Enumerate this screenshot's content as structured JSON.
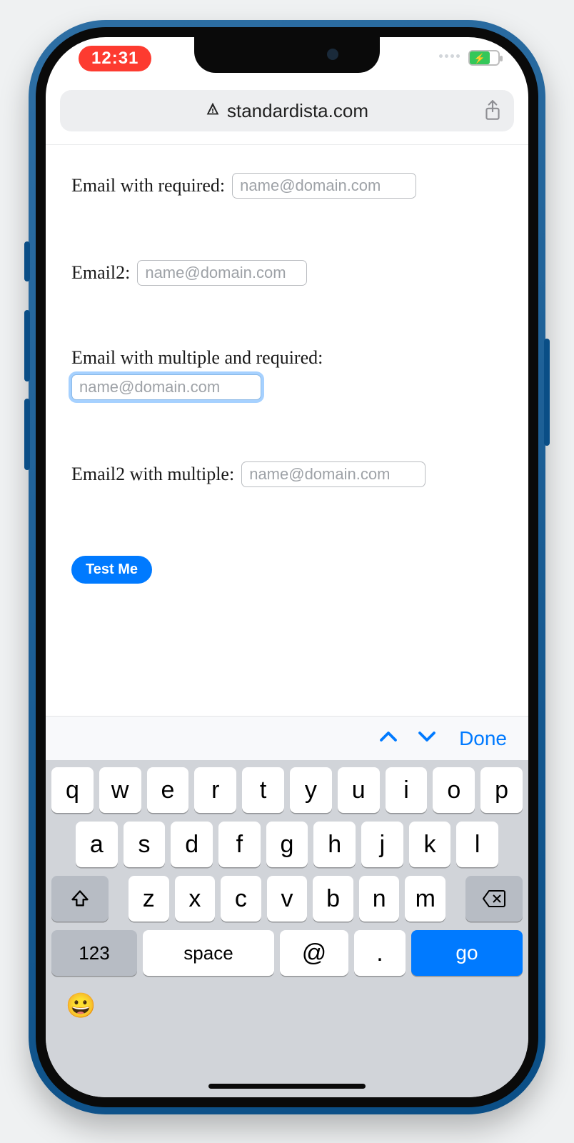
{
  "status": {
    "time": "12:31"
  },
  "address": {
    "domain": "standardista.com"
  },
  "form": {
    "fields": [
      {
        "label": "Email with required:",
        "placeholder": "name@domain.com"
      },
      {
        "label": "Email2:",
        "placeholder": "name@domain.com"
      },
      {
        "label": "Email with multiple and required:",
        "placeholder": "name@domain.com"
      },
      {
        "label": "Email2 with multiple:",
        "placeholder": "name@domain.com"
      }
    ],
    "submit_label": "Test Me"
  },
  "accessory": {
    "done_label": "Done"
  },
  "keyboard": {
    "row1": [
      "q",
      "w",
      "e",
      "r",
      "t",
      "y",
      "u",
      "i",
      "o",
      "p"
    ],
    "row2": [
      "a",
      "s",
      "d",
      "f",
      "g",
      "h",
      "j",
      "k",
      "l"
    ],
    "row3": [
      "z",
      "x",
      "c",
      "v",
      "b",
      "n",
      "m"
    ],
    "num_label": "123",
    "space_label": "space",
    "at_label": "@",
    "dot_label": ".",
    "go_label": "go"
  }
}
